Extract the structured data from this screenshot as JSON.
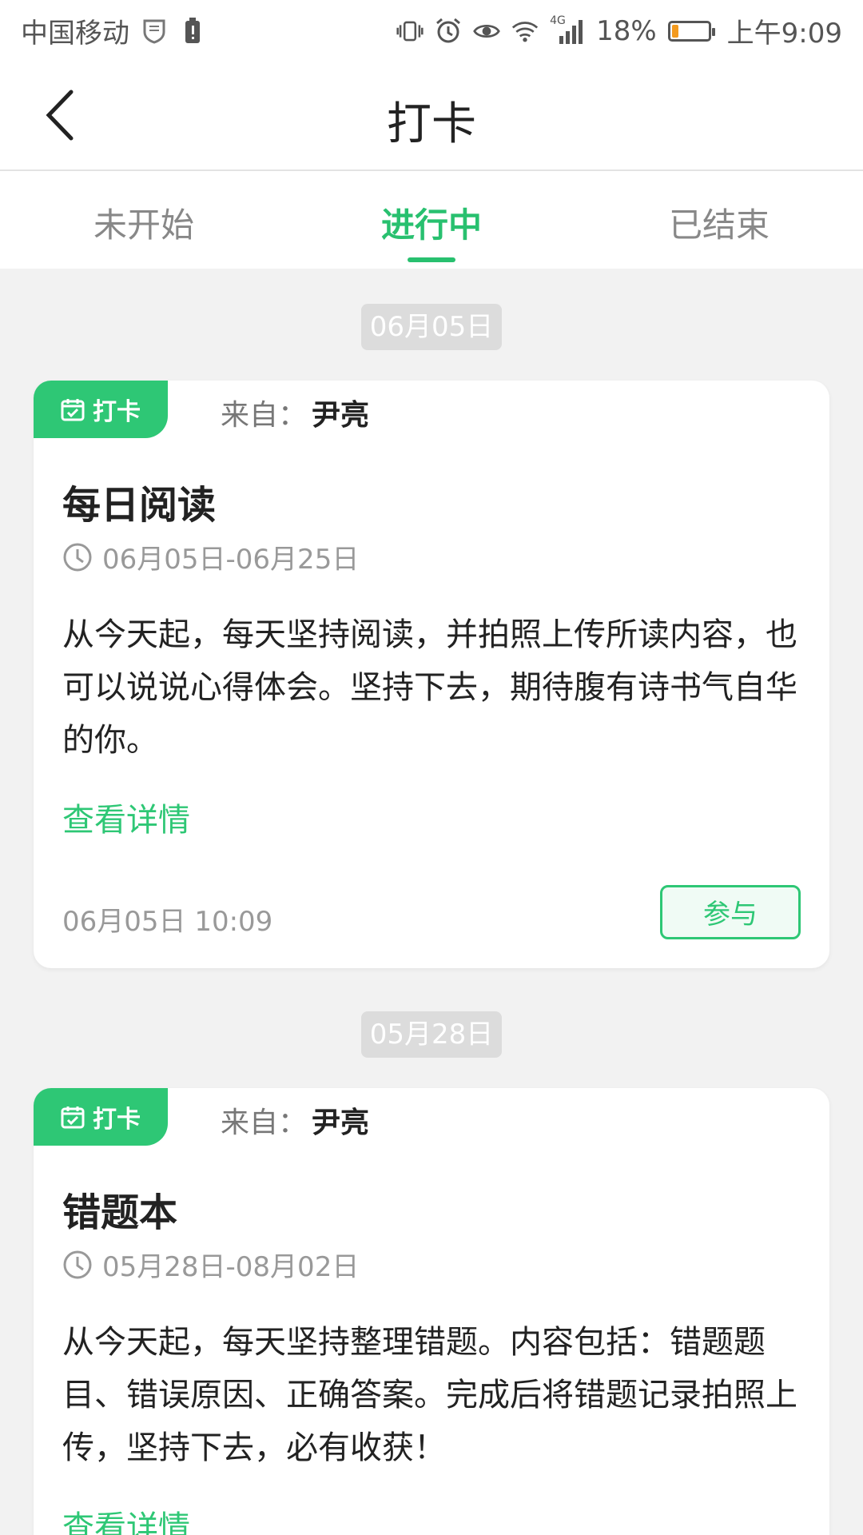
{
  "status_bar": {
    "carrier": "中国移动",
    "network": "4G",
    "battery_percent": "18%",
    "battery_level": 0.18,
    "time": "上午9:09",
    "icons": [
      "carrier-shield-icon",
      "battery-alert-icon",
      "vibrate-icon",
      "alarm-icon",
      "eye-icon",
      "wifi-icon",
      "signal-icon",
      "battery-icon"
    ]
  },
  "header": {
    "title": "打卡",
    "back_icon": "back-chevron-icon"
  },
  "tabs": [
    {
      "label": "未开始",
      "active": false
    },
    {
      "label": "进行中",
      "active": true
    },
    {
      "label": "已结束",
      "active": false
    }
  ],
  "colors": {
    "accent": "#2ec775",
    "tab_active": "#28c06f",
    "muted": "#999999"
  },
  "feed": [
    {
      "date": "06月05日",
      "tag": "打卡",
      "from_label": "来自：",
      "from_name": "尹亮",
      "title": "每日阅读",
      "period": "06月05日-06月25日",
      "description": "从今天起，每天坚持阅读，并拍照上传所读内容，也可以说说心得体会。坚持下去，期待腹有诗书气自华的你。",
      "detail_link": "查看详情",
      "posted": "06月05日 10:09",
      "action": "参与"
    },
    {
      "date": "05月28日",
      "tag": "打卡",
      "from_label": "来自：",
      "from_name": "尹亮",
      "title": "错题本",
      "period": "05月28日-08月02日",
      "description": "从今天起，每天坚持整理错题。内容包括：错题题目、错误原因、正确答案。完成后将错题记录拍照上传，坚持下去，必有收获！",
      "detail_link": "查看详情"
    }
  ]
}
